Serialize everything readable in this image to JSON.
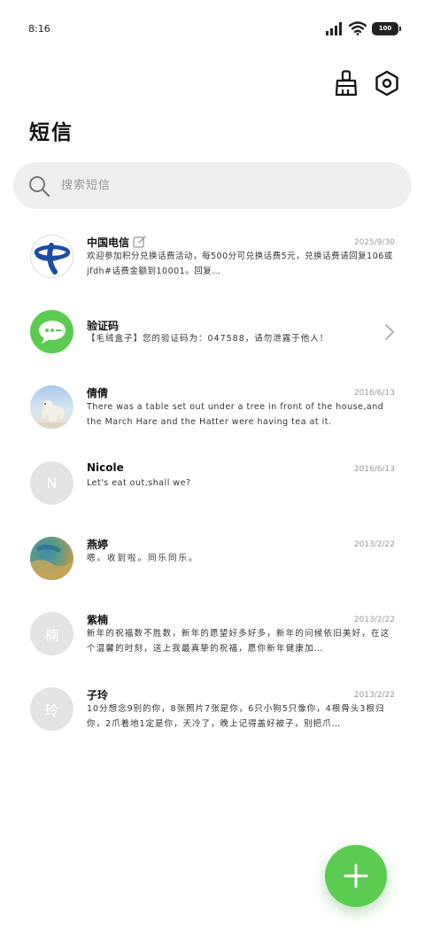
{
  "status_bar": {
    "time": "8:16",
    "battery": "100"
  },
  "header": {
    "title": "短信",
    "clean_icon": "broom-icon",
    "settings_icon": "settings-hexagon-icon"
  },
  "search": {
    "placeholder": "搜索短信"
  },
  "messages": [
    {
      "name": "中国电信",
      "date": "2025/9/30",
      "preview": "欢迎参加积分兑换话费活动，每500分可兑换话费5元，兑换话费请回复106或jfdh#话费金额到10001。回复…",
      "avatar": "china-telecom-logo",
      "badge_icon": "edit-icon"
    },
    {
      "name": "验证码",
      "date": "",
      "preview": "【毛绒盒子】您的验证码为：047588，请勿泄露于他人！",
      "avatar": "verification-chat-icon"
    },
    {
      "name": "倩倩",
      "date": "2016/6/13",
      "preview": "There was a table set out under a tree in front of the house,and the March Hare and the Hatter were having tea at it.",
      "avatar": "polar-bear-photo"
    },
    {
      "name": "Nicole",
      "date": "2016/6/13",
      "preview": "Let's eat out,shall we?",
      "avatar_letter": "N"
    },
    {
      "name": "燕婷",
      "date": "2013/2/22",
      "preview": "嗯。收到啦。同乐同乐。",
      "avatar": "landscape-photo"
    },
    {
      "name": "紫楠",
      "date": "2013/2/22",
      "preview": "新年的祝福数不胜数，新年的愿望好多好多，新年的问候依旧美好，在这个温馨的时刻，送上我最真挚的祝福，愿你新年健康加…",
      "avatar_letter": "楠"
    },
    {
      "name": "子玲",
      "date": "2013/2/22",
      "preview": "10分想念9别的你，8张照片7张是你，6只小狗5只像你，4根骨头3根归你，2爪着地1定是你，天冷了，晚上记得盖好被子，别把爪…",
      "avatar_letter": "玲"
    }
  ],
  "fab": {
    "icon": "plus-icon"
  },
  "colors": {
    "accent_green": "#5ccb52",
    "telecom_blue": "#1b4ea3",
    "search_bg": "#efefef"
  }
}
